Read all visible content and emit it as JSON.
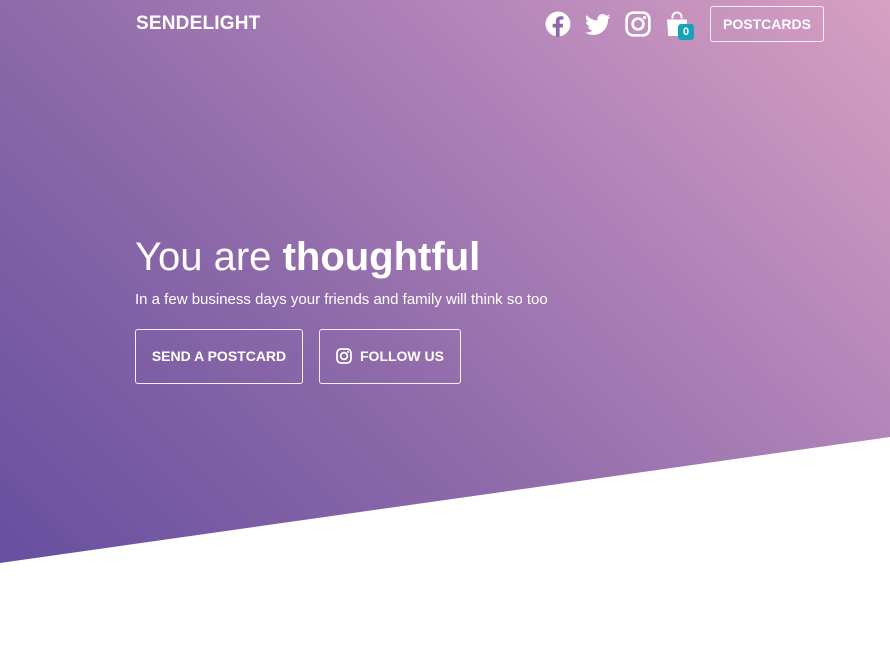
{
  "brand": {
    "name": "SENDELIGHT"
  },
  "nav": {
    "social_icons": [
      "facebook-icon",
      "twitter-icon",
      "instagram-icon"
    ],
    "cart": {
      "icon": "shopping-bag-icon",
      "count": "0"
    },
    "postcards_label": "POSTCARDS"
  },
  "hero": {
    "headline_prefix": "You are",
    "headline_emphasis": "thoughtful",
    "subtitle": "In a few business days your friends and family will think so too",
    "send_button_label": "SEND A POSTCARD",
    "follow_button_label": "FOLLOW US",
    "follow_button_icon": "instagram-icon"
  },
  "colors": {
    "gradient_start": "#5f4a9d",
    "gradient_end": "#d7a0c3",
    "badge": "#17a2b8",
    "text": "#ffffff"
  }
}
